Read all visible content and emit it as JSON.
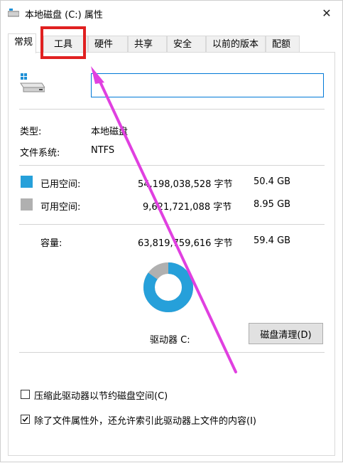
{
  "window": {
    "title": "本地磁盘 (C:) 属性",
    "close_glyph": "✕"
  },
  "tabs": [
    {
      "label": "常规",
      "active": true
    },
    {
      "label": "工具",
      "highlighted": true
    },
    {
      "label": "硬件"
    },
    {
      "label": "共享"
    },
    {
      "label": "安全"
    },
    {
      "label": "以前的版本"
    },
    {
      "label": "配额"
    }
  ],
  "general": {
    "name_value": "",
    "type_label": "类型:",
    "type_value": "本地磁盘",
    "fs_label": "文件系统:",
    "fs_value": "NTFS",
    "used": {
      "label": "已用空间:",
      "bytes": "54,198,038,528 字节",
      "size": "50.4 GB",
      "color": "#26a0da"
    },
    "free": {
      "label": "可用空间:",
      "bytes": "9,621,721,088 字节",
      "size": "8.95 GB",
      "color": "#b0b0b0"
    },
    "capacity": {
      "label": "容量:",
      "bytes": "63,819,759,616 字节",
      "size": "59.4 GB"
    },
    "used_fraction": 0.849,
    "drive_label": "驱动器 C:",
    "cleanup_button": "磁盘清理(D)",
    "compress_label": "压缩此驱动器以节约磁盘空间(C)",
    "compress_checked": false,
    "index_label": "除了文件属性外，还允许索引此驱动器上文件的内容(I)",
    "index_checked": true
  },
  "annotation": {
    "highlight_color": "#e02020",
    "arrow_color": "#e040e0"
  }
}
